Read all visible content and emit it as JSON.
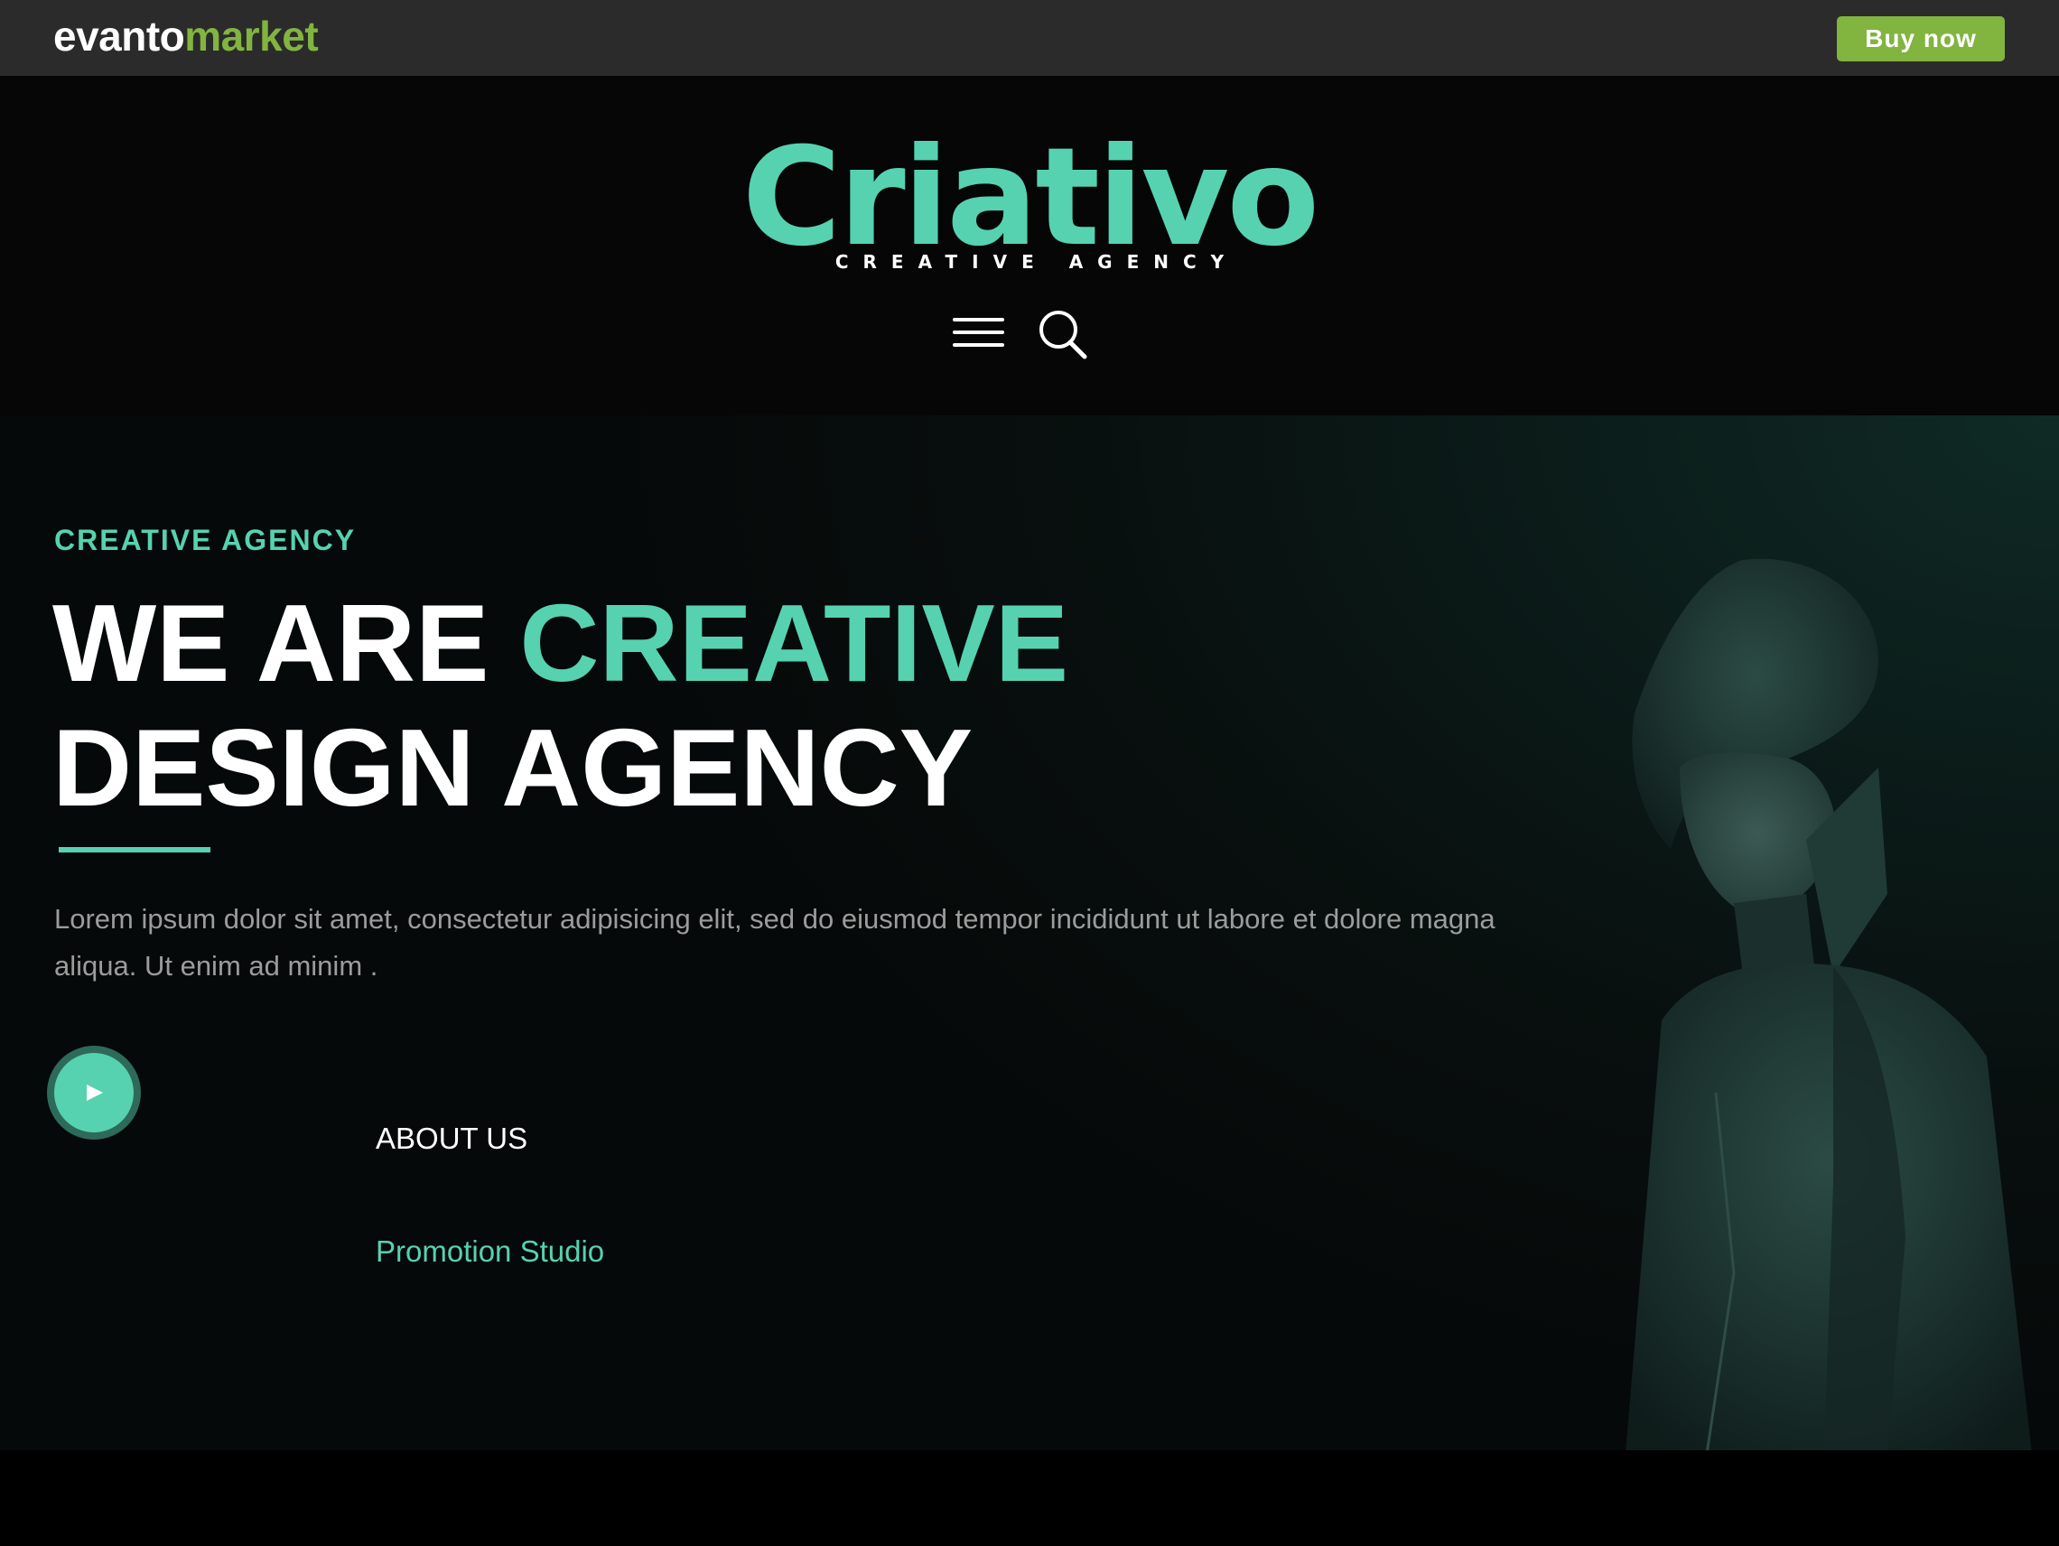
{
  "marketplace": {
    "logo_part1": "evanto",
    "logo_part2": "market",
    "buy_label": "Buy now"
  },
  "header": {
    "brand": "Criativo",
    "tagline": "CREATIVE AGENCY",
    "icons": [
      "menu-icon",
      "search-icon"
    ]
  },
  "hero": {
    "eyebrow": "CREATIVE AGENCY",
    "headline_line1_white": "WE ARE ",
    "headline_line1_accent": "CREATIVE",
    "headline_line2": "DESIGN AGENCY",
    "lead": "Lorem ipsum dolor sit amet, consectetur adipisicing elit, sed do eiusmod tempor incididunt ut labore et dolore magna aliqua. Ut enim ad minim .",
    "about_link": "ABOUT US",
    "promo_link": "Promotion Studio"
  },
  "colors": {
    "accent": "#56d2b0",
    "market_green": "#82b440",
    "topbar": "#2b2b2b",
    "background": "#060606"
  }
}
